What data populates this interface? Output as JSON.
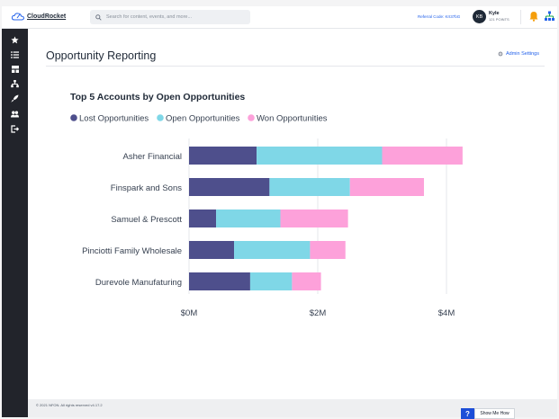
{
  "app": {
    "logo_text": "CloudRocket"
  },
  "search": {
    "placeholder": "Search for content, events, and more..."
  },
  "header": {
    "referral": "Referral Code: KrI37bG",
    "user_initials": "KB",
    "user_name": "Kyle",
    "user_points": "121 POINTS"
  },
  "sidebar": {
    "items": [
      {
        "icon": "star-icon"
      },
      {
        "icon": "list-icon"
      },
      {
        "icon": "dashboard-icon"
      },
      {
        "icon": "hierarchy-icon"
      },
      {
        "icon": "rocket-icon"
      },
      {
        "icon": "users-icon"
      },
      {
        "icon": "logout-icon"
      }
    ]
  },
  "page": {
    "title": "Opportunity Reporting",
    "admin_label": "Admin Settings"
  },
  "chart_data": {
    "type": "bar",
    "orientation": "horizontal",
    "stacked": true,
    "title": "Top 5 Accounts by Open Opportunities",
    "categories": [
      "Asher Financial",
      "Finspark and Sons",
      "Samuel & Prescott",
      "Pinciotti Family Wholesale",
      "Durevole Manufaturing"
    ],
    "series": [
      {
        "name": "Lost Opportunities",
        "color": "#4e4f8c",
        "values": [
          1.05,
          1.25,
          0.42,
          0.7,
          0.95
        ]
      },
      {
        "name": "Open Opportunities",
        "color": "#7fd7e7",
        "values": [
          1.95,
          1.25,
          1.0,
          1.18,
          0.65
        ]
      },
      {
        "name": "Won Opportunities",
        "color": "#fda1da",
        "values": [
          1.25,
          1.15,
          1.05,
          0.55,
          0.45
        ]
      }
    ],
    "xticks": [
      "$0M",
      "$2M",
      "$4M"
    ],
    "xtick_values": [
      0,
      2,
      4
    ],
    "xlim": [
      0,
      4.5
    ],
    "legend_position": "top-left"
  },
  "footer": {
    "copyright": "© 2021 NFON. All rights reserved v4.17.2",
    "help_q": "?",
    "help_label": "Show Me How"
  }
}
